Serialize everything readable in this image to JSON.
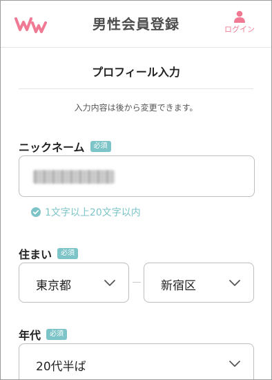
{
  "header": {
    "logo_text": "ww",
    "title": "男性会員登録",
    "login_label": "ログイン"
  },
  "section": {
    "title": "プロフィール入力",
    "note": "入力内容は後から変更できます。"
  },
  "fields": {
    "nickname": {
      "label": "ニックネーム",
      "badge": "必須",
      "hint": "1文字以上20文字以内"
    },
    "residence": {
      "label": "住まい",
      "badge": "必須",
      "prefecture": "東京都",
      "city": "新宿区"
    },
    "age": {
      "label": "年代",
      "badge": "必須",
      "value": "20代半ば"
    }
  },
  "colors": {
    "brand_pink": "#f07a93",
    "accent_teal": "#7cc4c7",
    "title_gray": "#4d4d4d"
  },
  "icons": {
    "login": "user-icon",
    "hint": "check-circle-icon",
    "select": "chevron-down-icon"
  }
}
